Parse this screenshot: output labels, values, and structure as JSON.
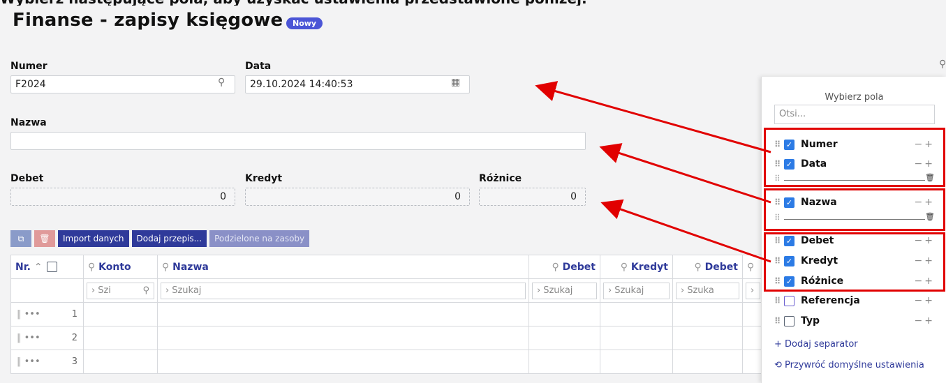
{
  "page": {
    "banner": "Wybierz następujące pola, aby uzyskać ustawienia przedstawione poniżej:",
    "title": "Finanse - zapisy księgowe",
    "badge": "Nowy"
  },
  "form": {
    "numer_label": "Numer",
    "numer_value": "F2024",
    "data_label": "Data",
    "data_value": "29.10.2024 14:40:53",
    "nazwa_label": "Nazwa",
    "nazwa_value": "",
    "debet_label": "Debet",
    "debet_value": "0",
    "kredyt_label": "Kredyt",
    "kredyt_value": "0",
    "roznice_label": "Różnice",
    "roznice_value": "0"
  },
  "toolbar": {
    "import": "Import danych",
    "add_template": "Dodaj przepis...",
    "split": "Podzielone na zasoby"
  },
  "table": {
    "headers": {
      "nr": "Nr.",
      "konto": "Konto",
      "nazwa": "Nazwa",
      "debet": "Debet",
      "kredyt": "Kredyt",
      "debet2": "Debet"
    },
    "filters": {
      "konto": "Szi",
      "nazwa": "Szukaj",
      "debet": "Szukaj",
      "kredyt": "Szukaj",
      "debet2": "Szuka"
    },
    "rows": [
      "1",
      "2",
      "3"
    ]
  },
  "panel": {
    "title": "Wybierz pola",
    "search_placeholder": "Otsi...",
    "fields": [
      {
        "label": "Numer",
        "checked": true
      },
      {
        "label": "Data",
        "checked": true
      },
      {
        "label": "Nazwa",
        "checked": true
      },
      {
        "label": "Debet",
        "checked": true
      },
      {
        "label": "Kredyt",
        "checked": true
      },
      {
        "label": "Różnice",
        "checked": true
      },
      {
        "label": "Referencja",
        "checked": false
      },
      {
        "label": "Typ",
        "checked": false
      }
    ],
    "add_separator": "Dodaj separator",
    "restore_defaults": "Przywróć domyślne ustawienia"
  },
  "colors": {
    "accent": "#2f3a9a",
    "checkbox": "#2c7be5",
    "highlight": "#e10000",
    "badge": "#4b55d6"
  }
}
